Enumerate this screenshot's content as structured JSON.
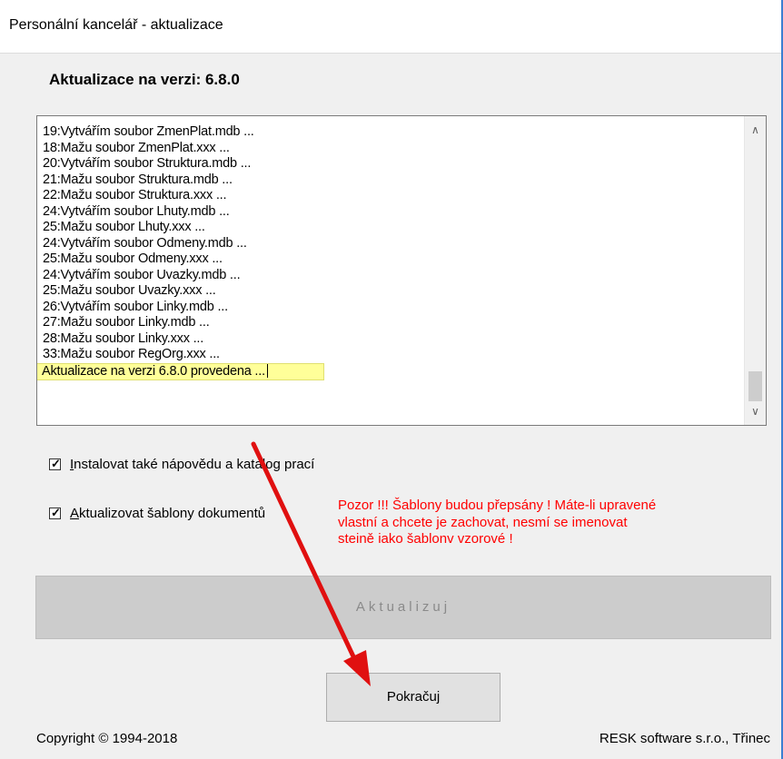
{
  "window": {
    "title": "Personální kancelář - aktualizace"
  },
  "heading": "Aktualizace na verzi: 6.8.0",
  "log": {
    "lines": [
      "19:Vytvářím soubor ZmenPlat.mdb ...",
      "18:Mažu soubor ZmenPlat.xxx ...",
      "20:Vytvářím soubor Struktura.mdb ...",
      "21:Mažu soubor Struktura.mdb ...",
      "22:Mažu soubor Struktura.xxx ...",
      "24:Vytvářím soubor Lhuty.mdb ...",
      "25:Mažu soubor Lhuty.xxx ...",
      "24:Vytvářím soubor Odmeny.mdb ...",
      "25:Mažu soubor Odmeny.xxx ...",
      "24:Vytvářím soubor Uvazky.mdb ...",
      "25:Mažu soubor Uvazky.xxx ...",
      "26:Vytvářím soubor Linky.mdb ...",
      "27:Mažu soubor Linky.mdb ...",
      "28:Mažu soubor Linky.xxx ...",
      "33:Mažu soubor RegOrg.xxx ..."
    ],
    "highlighted_line": "Aktualizace na verzi 6.8.0 provedena ..."
  },
  "options": {
    "help": {
      "label": "Instalovat také nápovědu a katalog prací",
      "checked": true
    },
    "templates": {
      "label": "Aktualizovat šablony dokumentů",
      "checked": true
    }
  },
  "warning": "Pozor !!! Šablony budou přepsány ! Máte-li upravené vlastní a chcete je zachovat, nesmí se imenovat steině iako šablonv vzorové !",
  "buttons": {
    "update": "Aktualizuj",
    "continue": "Pokračuj"
  },
  "footer": {
    "copyright": "Copyright © 1994-2018",
    "company": "RESK software s.r.o., Třinec"
  },
  "colors": {
    "warning": "#ff0000",
    "highlight": "#ffff99",
    "arrow": "#e01010"
  }
}
